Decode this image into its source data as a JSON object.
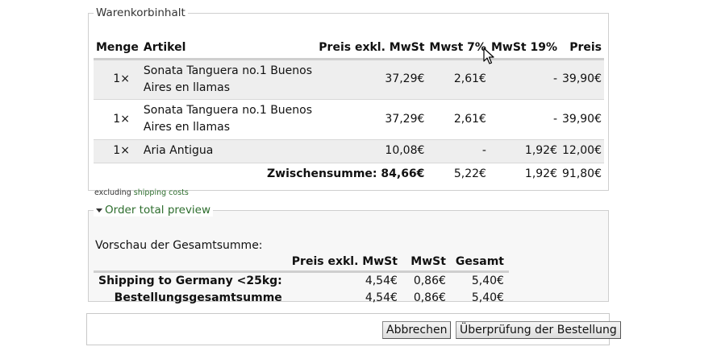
{
  "cart": {
    "legend": "Warenkorbinhalt",
    "headers": {
      "qty": "Menge",
      "article": "Artikel",
      "net": "Preis exkl. MwSt",
      "vat7": "Mwst 7%",
      "vat19": "MwSt 19%",
      "price": "Preis"
    },
    "rows": [
      {
        "qty": "1×",
        "article": "Sonata Tanguera no.1 Buenos Aires en llamas",
        "net": "37,29€",
        "vat7": "2,61€",
        "vat19": "-",
        "price": "39,90€"
      },
      {
        "qty": "1×",
        "article": "Sonata Tanguera no.1 Buenos Aires en llamas",
        "net": "37,29€",
        "vat7": "2,61€",
        "vat19": "-",
        "price": "39,90€"
      },
      {
        "qty": "1×",
        "article": "Aria Antigua",
        "net": "10,08€",
        "vat7": "-",
        "vat19": "1,92€",
        "price": "12,00€"
      }
    ],
    "subtotal": {
      "label": "Zwischensumme:",
      "net": "84,66€",
      "vat7": "5,22€",
      "vat19": "1,92€",
      "price": "91,80€"
    },
    "shipping_note": {
      "prefix": "excluding",
      "link": "shipping costs"
    }
  },
  "order_preview": {
    "legend": "Order total preview",
    "title": "Vorschau der Gesamtsumme:",
    "headers": {
      "net": "Preis exkl. MwSt",
      "vat": "MwSt",
      "total": "Gesamt"
    },
    "rows": [
      {
        "label": "Shipping to Germany <25kg:",
        "net": "4,54€",
        "vat": "0,86€",
        "total": "5,40€"
      },
      {
        "label": "Bestellungsgesamtsumme",
        "net": "4,54€",
        "vat": "0,86€",
        "total": "5,40€"
      }
    ]
  },
  "actions": {
    "cancel_label": "Abbrechen",
    "review_label": "Überprüfung der Bestellung"
  },
  "icons": {
    "legend_toggle": "triangle-down-icon",
    "cursor": "mouse-pointer-icon"
  }
}
